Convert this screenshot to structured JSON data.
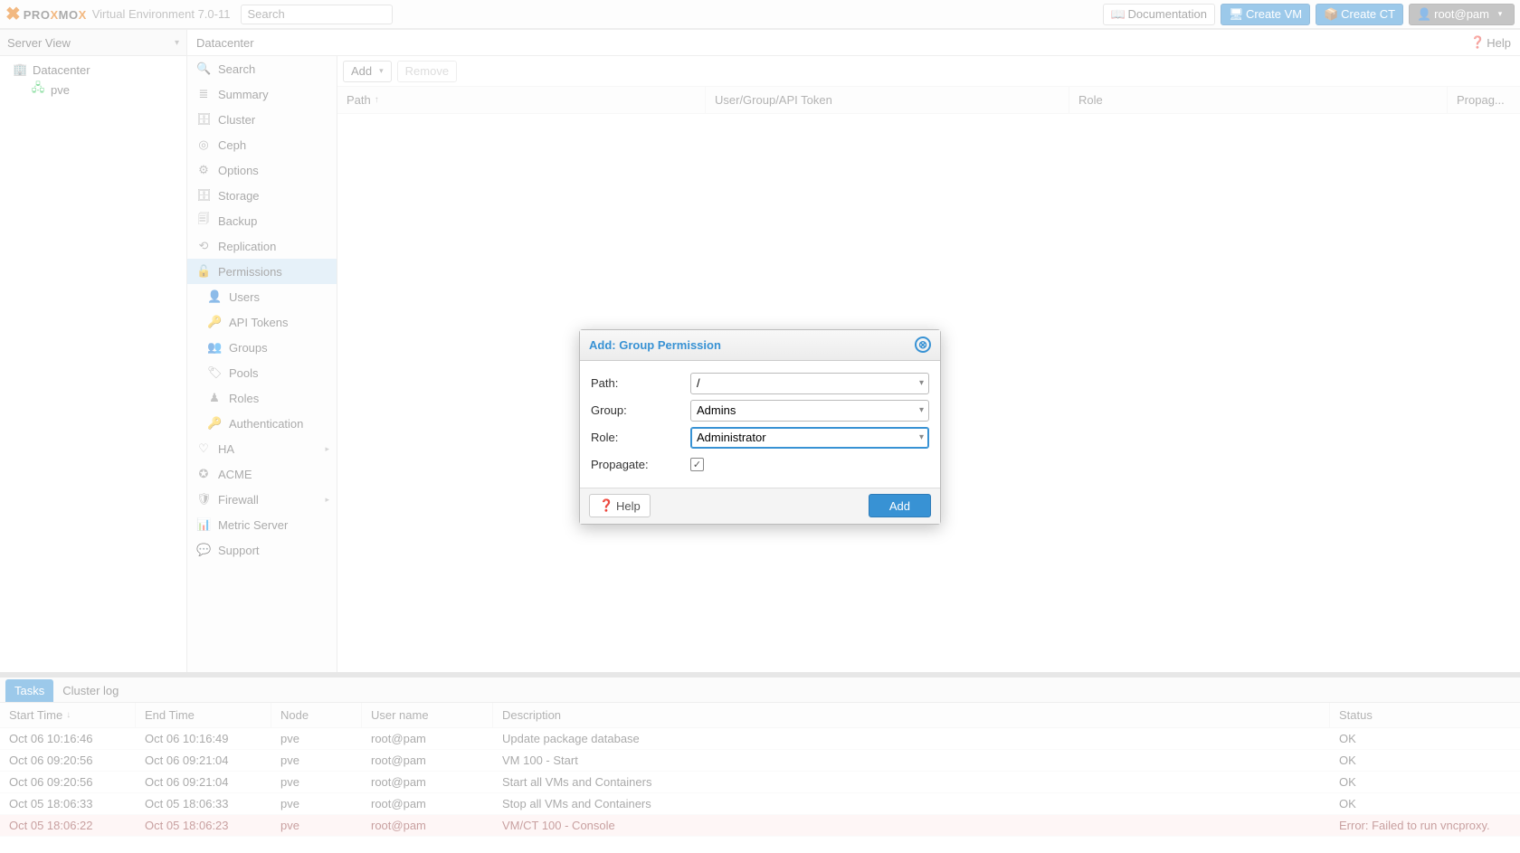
{
  "header": {
    "title_env": "Virtual Environment",
    "version": "7.0-11",
    "search_placeholder": "Search",
    "buttons": {
      "docs": "Documentation",
      "create_vm": "Create VM",
      "create_ct": "Create CT",
      "user": "root@pam"
    }
  },
  "nav": {
    "view_title": "Server View",
    "items": [
      {
        "label": "Datacenter",
        "icon": "datacenter"
      },
      {
        "label": "pve",
        "icon": "node",
        "child": true
      }
    ]
  },
  "crumb": {
    "title": "Datacenter",
    "help": "Help"
  },
  "config_sidebar": [
    {
      "label": "Search",
      "icon": "🔍"
    },
    {
      "label": "Summary",
      "icon": "≣"
    },
    {
      "label": "Cluster",
      "icon": "🗄"
    },
    {
      "label": "Ceph",
      "icon": "◎"
    },
    {
      "label": "Options",
      "icon": "⚙"
    },
    {
      "label": "Storage",
      "icon": "🗄"
    },
    {
      "label": "Backup",
      "icon": "🗐"
    },
    {
      "label": "Replication",
      "icon": "⟲"
    },
    {
      "label": "Permissions",
      "icon": "🔓",
      "selected": true
    },
    {
      "label": "Users",
      "icon": "👤",
      "sub": true
    },
    {
      "label": "API Tokens",
      "icon": "🔑",
      "sub": true
    },
    {
      "label": "Groups",
      "icon": "👥",
      "sub": true
    },
    {
      "label": "Pools",
      "icon": "🏷",
      "sub": true
    },
    {
      "label": "Roles",
      "icon": "♟",
      "sub": true
    },
    {
      "label": "Authentication",
      "icon": "🔑",
      "sub": true
    },
    {
      "label": "HA",
      "icon": "♡",
      "arrow": true
    },
    {
      "label": "ACME",
      "icon": "✪"
    },
    {
      "label": "Firewall",
      "icon": "🛡",
      "arrow": true
    },
    {
      "label": "Metric Server",
      "icon": "📊"
    },
    {
      "label": "Support",
      "icon": "💬"
    }
  ],
  "grid": {
    "add_btn": "Add",
    "remove_btn": "Remove",
    "columns": {
      "path": "Path",
      "user": "User/Group/API Token",
      "role": "Role",
      "prop": "Propag..."
    }
  },
  "modal": {
    "title": "Add: Group Permission",
    "fields": {
      "path_label": "Path:",
      "path_value": "/",
      "group_label": "Group:",
      "group_value": "Admins",
      "role_label": "Role:",
      "role_value": "Administrator",
      "propagate_label": "Propagate:",
      "propagate_checked": true
    },
    "help": "Help",
    "add": "Add"
  },
  "log": {
    "tabs": {
      "tasks": "Tasks",
      "cluster": "Cluster log"
    },
    "columns": {
      "start": "Start Time",
      "end": "End Time",
      "node": "Node",
      "user": "User name",
      "desc": "Description",
      "status": "Status"
    },
    "rows": [
      {
        "start": "Oct 06 10:16:46",
        "end": "Oct 06 10:16:49",
        "node": "pve",
        "user": "root@pam",
        "desc": "Update package database",
        "status": "OK"
      },
      {
        "start": "Oct 06 09:20:56",
        "end": "Oct 06 09:21:04",
        "node": "pve",
        "user": "root@pam",
        "desc": "VM 100 - Start",
        "status": "OK"
      },
      {
        "start": "Oct 06 09:20:56",
        "end": "Oct 06 09:21:04",
        "node": "pve",
        "user": "root@pam",
        "desc": "Start all VMs and Containers",
        "status": "OK"
      },
      {
        "start": "Oct 05 18:06:33",
        "end": "Oct 05 18:06:33",
        "node": "pve",
        "user": "root@pam",
        "desc": "Stop all VMs and Containers",
        "status": "OK"
      },
      {
        "start": "Oct 05 18:06:22",
        "end": "Oct 05 18:06:23",
        "node": "pve",
        "user": "root@pam",
        "desc": "VM/CT 100 - Console",
        "status": "Error: Failed to run vncproxy.",
        "error": true
      }
    ]
  }
}
